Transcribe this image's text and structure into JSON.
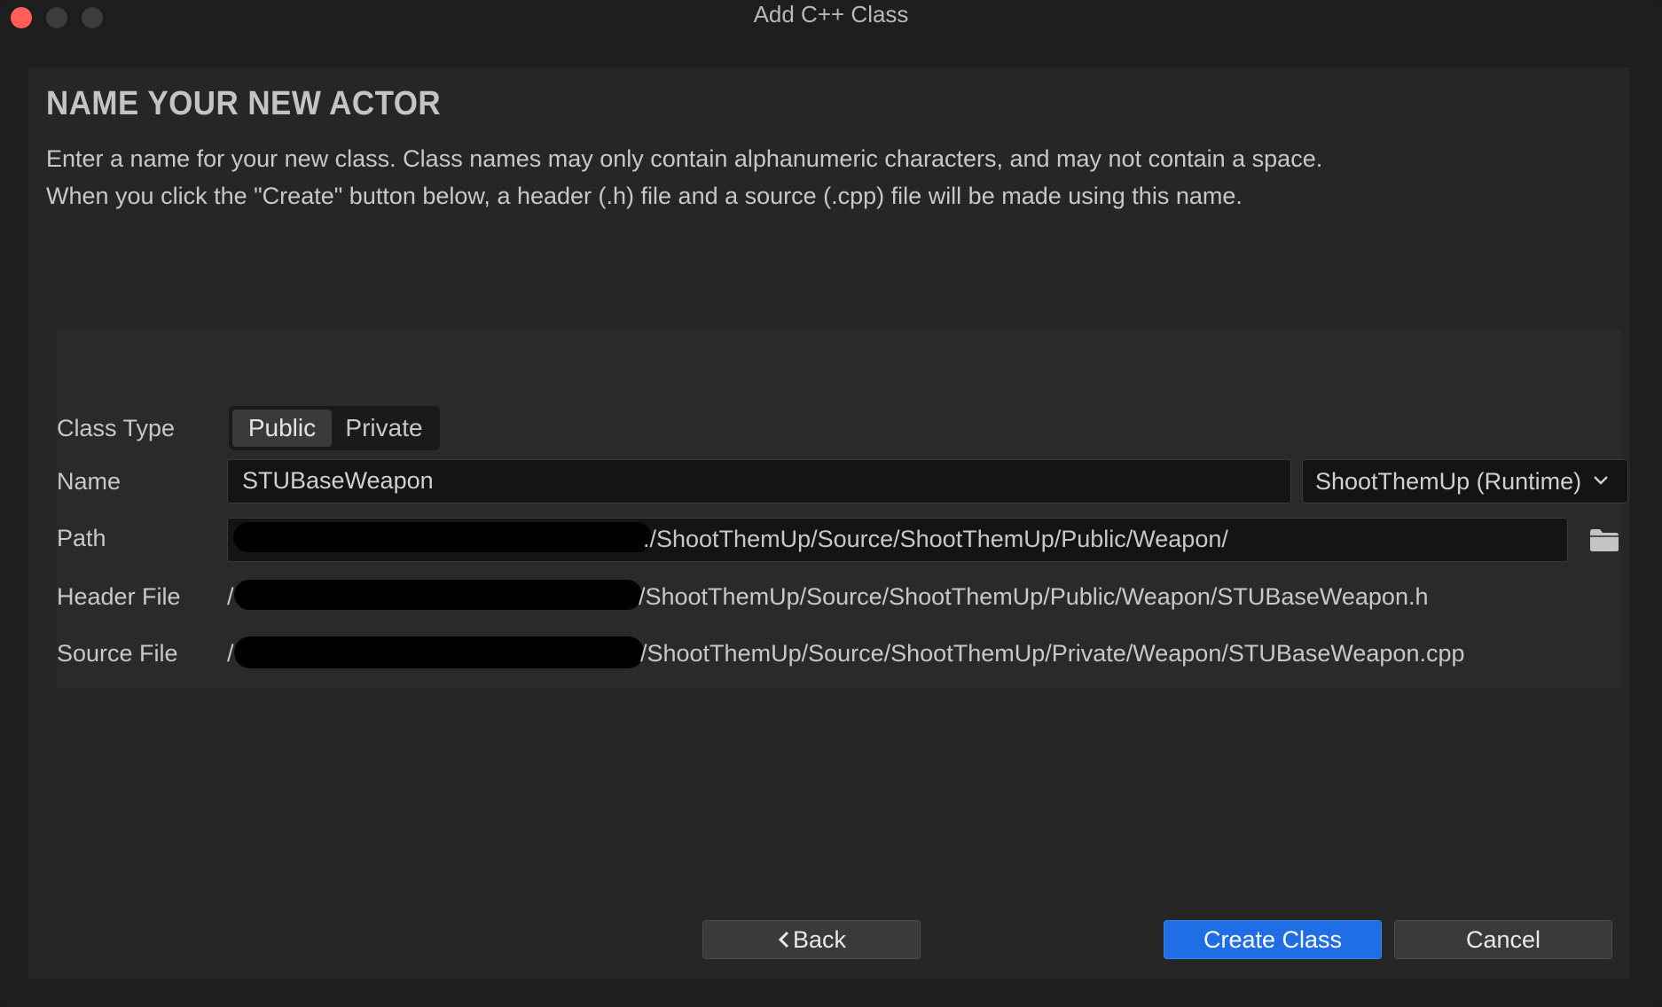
{
  "window": {
    "title": "Add C++ Class"
  },
  "page": {
    "heading": "NAME YOUR NEW ACTOR",
    "description_line1": "Enter a name for your new class. Class names may only contain alphanumeric characters, and may not contain a space.",
    "description_line2": "When you click the \"Create\" button below, a header (.h) file and a source (.cpp) file will be made using this name."
  },
  "form": {
    "class_type_label": "Class Type",
    "class_type_options": [
      "Public",
      "Private"
    ],
    "class_type_selected": "Public",
    "name_label": "Name",
    "name_value": "STUBaseWeapon",
    "module_value": "ShootThemUp (Runtime)",
    "path_label": "Path",
    "path_value_visible": "./ShootThemUp/Source/ShootThemUp/Public/Weapon/",
    "header_label": "Header File",
    "header_prefix": "/",
    "header_value_visible": "/ShootThemUp/Source/ShootThemUp/Public/Weapon/STUBaseWeapon.h",
    "source_label": "Source File",
    "source_prefix": "/",
    "source_value_visible": "/ShootThemUp/Source/ShootThemUp/Private/Weapon/STUBaseWeapon.cpp"
  },
  "buttons": {
    "back": "Back",
    "create": "Create Class",
    "cancel": "Cancel"
  },
  "colors": {
    "primary_button": "#1f6ee6",
    "close_traffic_light": "#ff5f57"
  }
}
